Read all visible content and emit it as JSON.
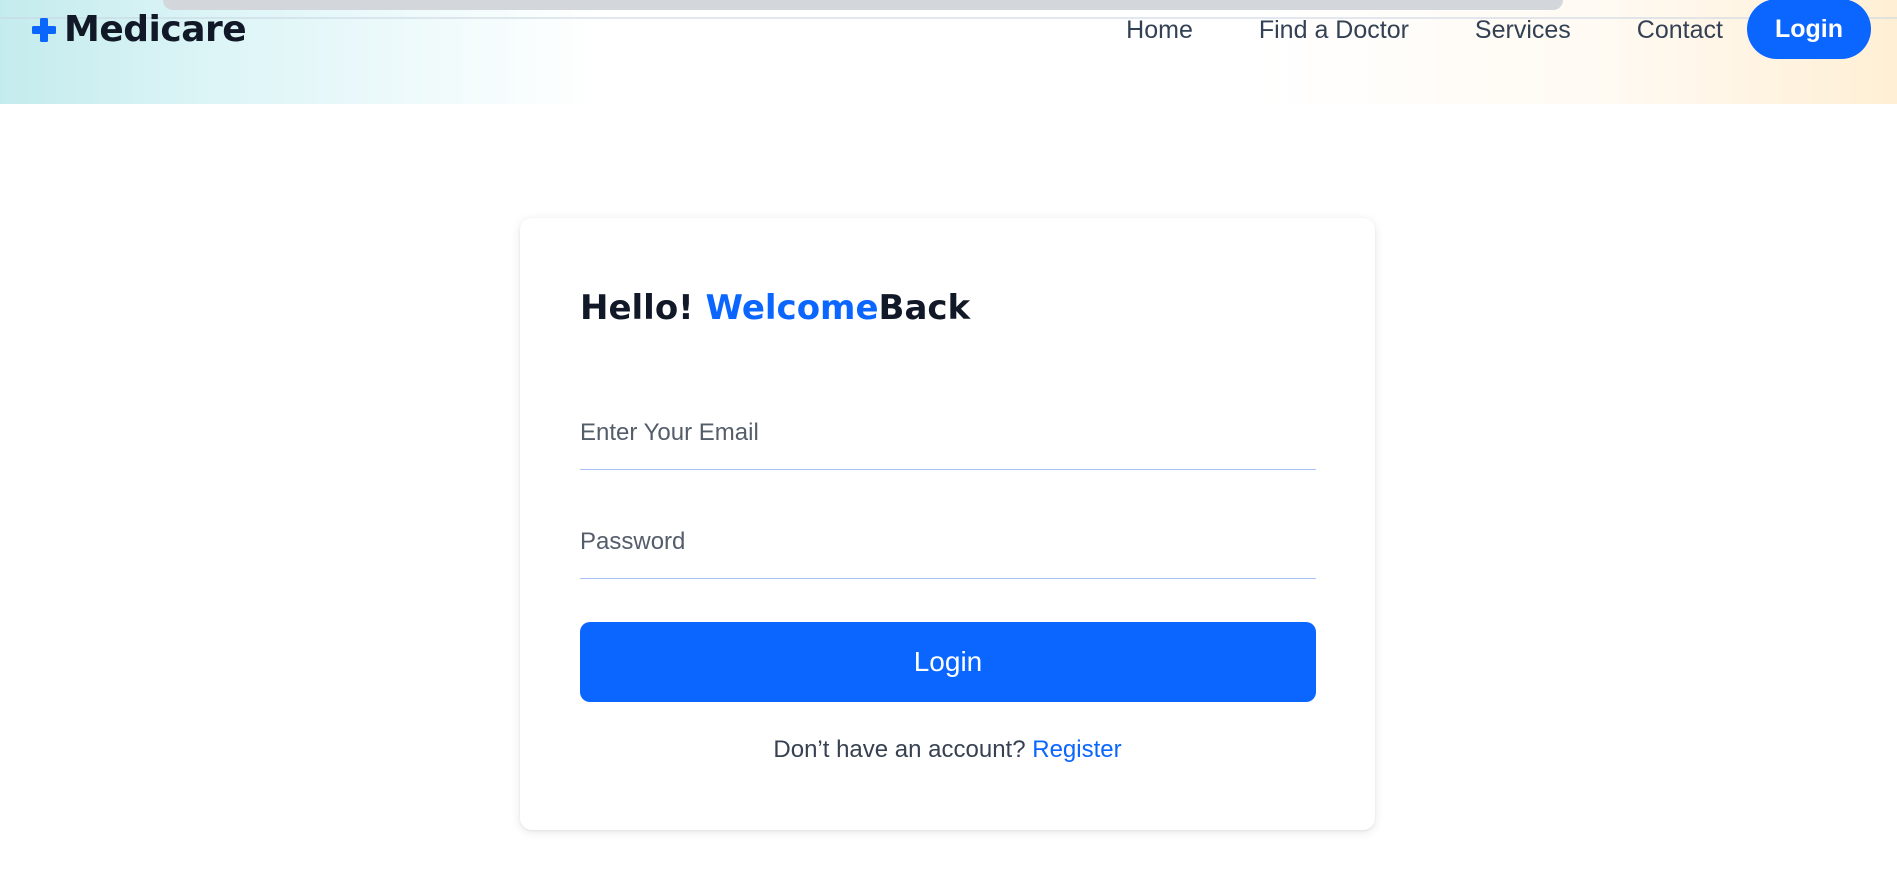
{
  "brand": {
    "name": "Medicare",
    "icon": "plus-cross-icon",
    "accent_color": "#0a66ff"
  },
  "nav": {
    "items": [
      {
        "label": "Home"
      },
      {
        "label": "Find a Doctor"
      },
      {
        "label": "Services"
      },
      {
        "label": "Contact"
      }
    ],
    "login_label": "Login"
  },
  "card": {
    "heading": {
      "part1": "Hello! ",
      "accent": "Welcome",
      "part2": "Back"
    },
    "email": {
      "placeholder": "Enter Your Email",
      "value": ""
    },
    "password": {
      "placeholder": "Password",
      "value": ""
    },
    "login_button_label": "Login",
    "register_prompt": "Don’t have an account? ",
    "register_link": "Register"
  },
  "colors": {
    "primary": "#0a66ff",
    "text": "#1f2937",
    "muted": "#374151"
  }
}
